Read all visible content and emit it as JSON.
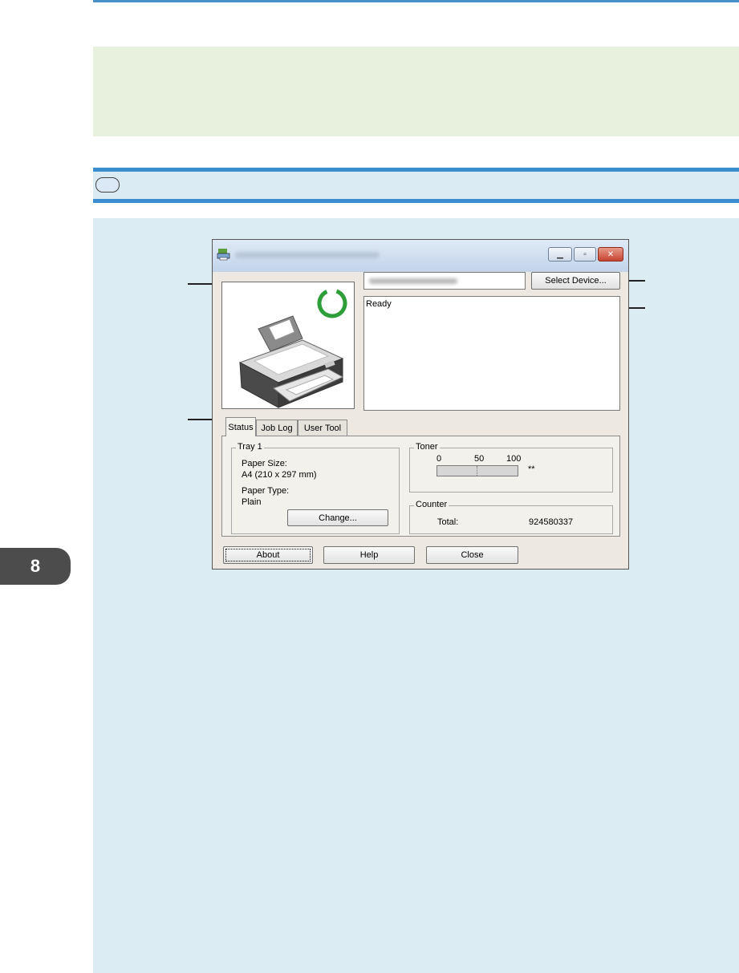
{
  "chapter": {
    "number": "8"
  },
  "window": {
    "status_text": "Ready",
    "select_device_label": "Select Device...",
    "tabs": [
      "Status",
      "Job Log",
      "User Tool"
    ],
    "tray": {
      "group_title": "Tray 1",
      "paper_size_label": "Paper Size:",
      "paper_size_value": "A4 (210 x 297 mm)",
      "paper_type_label": "Paper Type:",
      "paper_type_value": "Plain",
      "change_label": "Change..."
    },
    "toner": {
      "group_title": "Toner",
      "scale": [
        "0",
        "50",
        "100"
      ],
      "level_text": "**"
    },
    "counter": {
      "group_title": "Counter",
      "total_label": "Total:",
      "total_value": "924580337"
    },
    "buttons": {
      "about": "About",
      "help": "Help",
      "close": "Close"
    },
    "status_icon_color": "#2e9e3a"
  }
}
